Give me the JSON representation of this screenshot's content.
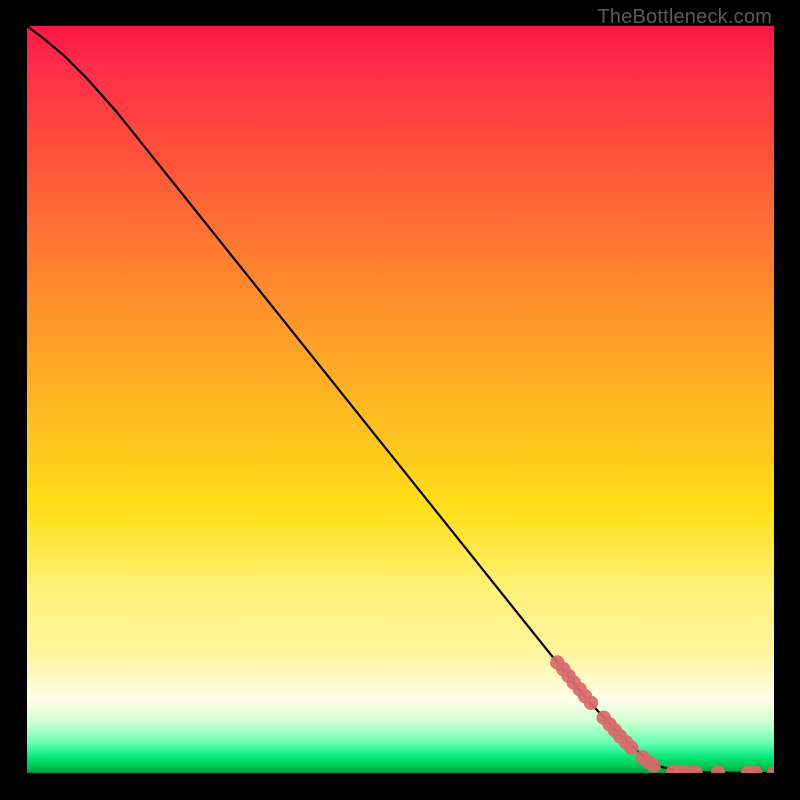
{
  "watermark": "TheBottleneck.com",
  "chart_data": {
    "type": "line",
    "title": "",
    "xlabel": "",
    "ylabel": "",
    "xlim": [
      0,
      100
    ],
    "ylim": [
      0,
      100
    ],
    "grid": false,
    "legend": false,
    "series": [
      {
        "name": "curve",
        "type": "line",
        "color": "#000000",
        "points": [
          {
            "x": 0.0,
            "y": 100.0
          },
          {
            "x": 2.0,
            "y": 98.5
          },
          {
            "x": 5.0,
            "y": 96.0
          },
          {
            "x": 8.0,
            "y": 93.0
          },
          {
            "x": 12.0,
            "y": 88.5
          },
          {
            "x": 16.0,
            "y": 83.5
          },
          {
            "x": 20.0,
            "y": 78.5
          },
          {
            "x": 30.0,
            "y": 66.0
          },
          {
            "x": 40.0,
            "y": 53.5
          },
          {
            "x": 50.0,
            "y": 41.0
          },
          {
            "x": 60.0,
            "y": 28.5
          },
          {
            "x": 70.0,
            "y": 16.0
          },
          {
            "x": 75.0,
            "y": 9.8
          },
          {
            "x": 80.0,
            "y": 4.5
          },
          {
            "x": 83.0,
            "y": 1.8
          },
          {
            "x": 85.0,
            "y": 0.8
          },
          {
            "x": 87.0,
            "y": 0.3
          },
          {
            "x": 90.0,
            "y": 0.1
          },
          {
            "x": 95.0,
            "y": 0.0
          },
          {
            "x": 100.0,
            "y": 0.0
          }
        ]
      },
      {
        "name": "dots",
        "type": "scatter",
        "color": "#d86a6a",
        "points": [
          {
            "x": 71.0,
            "y": 14.8
          },
          {
            "x": 71.8,
            "y": 13.9
          },
          {
            "x": 72.5,
            "y": 13.0
          },
          {
            "x": 73.2,
            "y": 12.1
          },
          {
            "x": 74.0,
            "y": 11.2
          },
          {
            "x": 74.7,
            "y": 10.3
          },
          {
            "x": 75.5,
            "y": 9.4
          },
          {
            "x": 77.2,
            "y": 7.4
          },
          {
            "x": 78.0,
            "y": 6.5
          },
          {
            "x": 78.7,
            "y": 5.7
          },
          {
            "x": 79.4,
            "y": 4.9
          },
          {
            "x": 80.2,
            "y": 4.1
          },
          {
            "x": 80.9,
            "y": 3.4
          },
          {
            "x": 82.4,
            "y": 2.1
          },
          {
            "x": 83.2,
            "y": 1.5
          },
          {
            "x": 83.9,
            "y": 1.0
          },
          {
            "x": 86.5,
            "y": 0.2
          },
          {
            "x": 87.5,
            "y": 0.15
          },
          {
            "x": 88.5,
            "y": 0.1
          },
          {
            "x": 89.5,
            "y": 0.08
          },
          {
            "x": 92.5,
            "y": 0.05
          },
          {
            "x": 96.5,
            "y": 0.02
          },
          {
            "x": 97.5,
            "y": 0.02
          },
          {
            "x": 100.0,
            "y": 0.0
          }
        ]
      }
    ]
  }
}
